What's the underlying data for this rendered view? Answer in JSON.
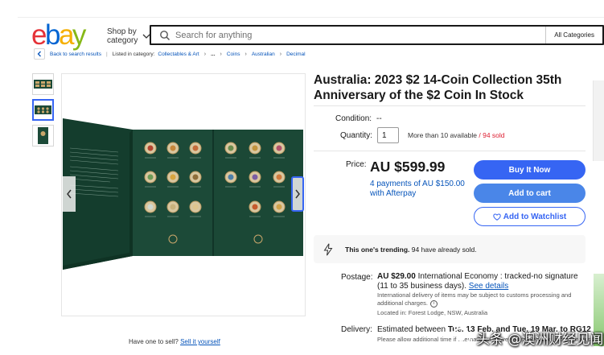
{
  "header": {
    "logo_letters": [
      "e",
      "b",
      "a",
      "y"
    ],
    "shop_by_line1": "Shop by",
    "shop_by_line2": "category",
    "search_placeholder": "Search for anything",
    "categories_label": "All Categories"
  },
  "breadcrumb": {
    "back_label": "Back to search results",
    "listed_in": "Listed in category:",
    "items": [
      "Collectables & Art",
      "...",
      "Coins",
      "Australian",
      "Decimal"
    ]
  },
  "gallery": {
    "thumb_count": 3,
    "active_thumb": 2
  },
  "sell_hint": {
    "text": "Have one to sell?",
    "link": "Sell it yourself"
  },
  "listing": {
    "title": "Australia: 2023 $2 14-Coin Collection 35th Anniversary of the $2 Coin In Stock",
    "condition_label": "Condition:",
    "condition_value": "--",
    "quantity_label": "Quantity:",
    "quantity_value": "1",
    "availability": "More than 10 available",
    "sold": "/ 94 sold",
    "price_label": "Price:",
    "price": "AU $599.99",
    "afterpay": "4 payments of AU $150.00 with Afterpay",
    "buy_now": "Buy It Now",
    "add_to_cart": "Add to cart",
    "add_to_watchlist": "Add to Watchlist",
    "trending_bold": "This one's trending.",
    "trending_rest": "94 have already sold.",
    "postage_label": "Postage:",
    "postage_price": "AU $29.00",
    "postage_service": "International Economy : tracked-no signature (11 to 35 business days).",
    "see_details": "See details",
    "postage_note": "International delivery of items may be subject to customs processing and additional charges.",
    "located": "Located in: Forest Lodge, NSW, Australia",
    "delivery_label": "Delivery:",
    "delivery_prefix": "Estimated between",
    "delivery_dates": "Tue. 13 Feb. and Tue. 19 Mar. to RG12 1PN",
    "delivery_note": "Please allow additional time if international delivery is subject to customs processing."
  },
  "watermark": {
    "text": "头条 @澳洲财经见闻"
  },
  "colors": {
    "accent": "#3665f3",
    "link": "#0654ba",
    "sold": "#dd1e31",
    "folder_green": "#1c4a38"
  },
  "icons": [
    "chevron-down-icon",
    "search-icon",
    "back-arrow-icon",
    "chevron-left-icon",
    "chevron-right-icon",
    "heart-icon",
    "lightning-icon",
    "info-icon"
  ]
}
